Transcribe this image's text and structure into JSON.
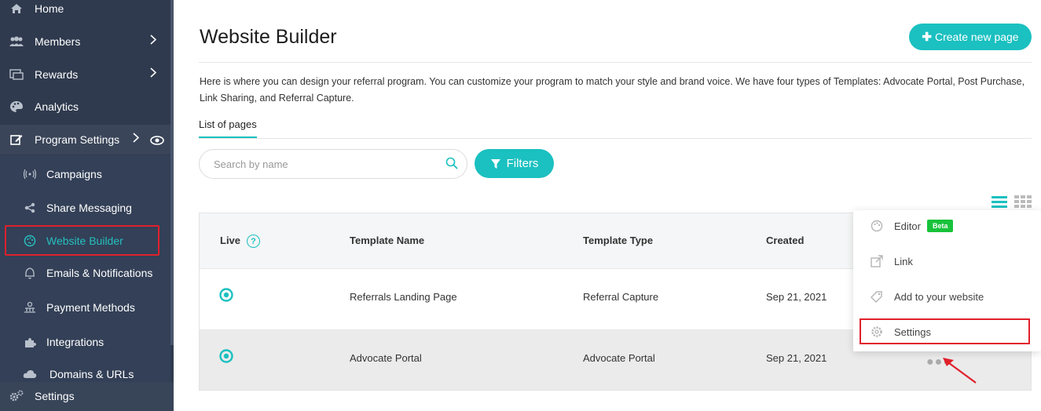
{
  "sidebar": {
    "items": [
      {
        "label": "Home",
        "icon": "home-icon"
      },
      {
        "label": "Members",
        "icon": "users-icon"
      },
      {
        "label": "Rewards",
        "icon": "rewards-icon"
      },
      {
        "label": "Analytics",
        "icon": "palette-icon"
      },
      {
        "label": "Program Settings",
        "icon": "edit-icon"
      }
    ],
    "subitems": [
      {
        "label": "Campaigns",
        "icon": "broadcast-icon"
      },
      {
        "label": "Share Messaging",
        "icon": "share-icon"
      },
      {
        "label": "Website Builder",
        "icon": "palette-icon"
      },
      {
        "label": "Emails & Notifications",
        "icon": "bell-icon"
      },
      {
        "label": "Payment Methods",
        "icon": "payment-icon"
      },
      {
        "label": "Integrations",
        "icon": "puzzle-icon"
      },
      {
        "label": "Domains & URLs",
        "icon": "cloud-icon"
      }
    ],
    "bottom": {
      "label": "Settings",
      "icon": "gears-icon"
    }
  },
  "header": {
    "title": "Website Builder",
    "create_button": "Create new page"
  },
  "description": "Here is where you can design your referral program. You can customize your program to match your style and brand voice. We have four types of Templates: Advocate Portal, Post Purchase, Link Sharing, and Referral Capture.",
  "tabs": [
    {
      "label": "List of pages"
    }
  ],
  "search": {
    "placeholder": "Search by name"
  },
  "filters_label": "Filters",
  "table": {
    "columns": [
      "Live",
      "Template Name",
      "Template Type",
      "Created"
    ],
    "rows": [
      {
        "name": "Referrals Landing Page",
        "type": "Referral Capture",
        "created": "Sep 21, 2021"
      },
      {
        "name": "Advocate Portal",
        "type": "Advocate Portal",
        "created": "Sep 21, 2021"
      }
    ]
  },
  "menu": {
    "items": [
      {
        "label": "Editor",
        "icon": "palette-icon"
      },
      {
        "label": "Link",
        "icon": "external-link-icon"
      },
      {
        "label": "Add to your website",
        "icon": "tag-icon"
      },
      {
        "label": "Settings",
        "icon": "gear-icon"
      }
    ],
    "beta_badge": "Beta"
  },
  "colors": {
    "accent": "#1bc0c0",
    "sidebar": "#2f3a4e",
    "highlight": "#e0202b",
    "beta": "#18c23a"
  }
}
